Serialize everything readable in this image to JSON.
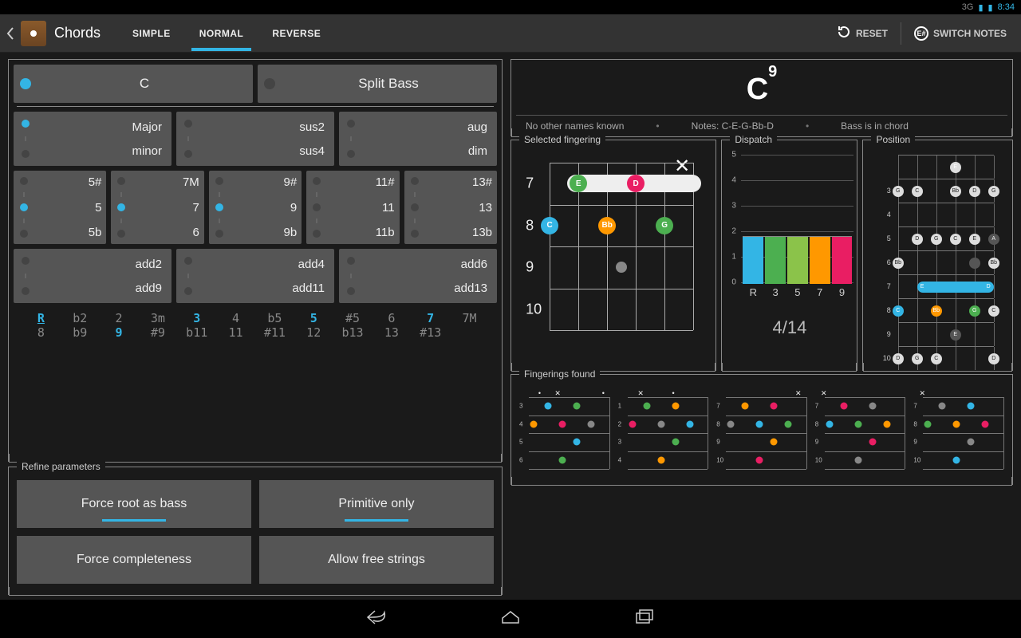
{
  "statusbar": {
    "net": "3G",
    "time": "8:34"
  },
  "appbar": {
    "title": "Chords",
    "tabs": [
      "SIMPLE",
      "NORMAL",
      "REVERSE"
    ],
    "active_tab": 1,
    "reset": "RESET",
    "switch": "SWITCH NOTES",
    "switch_icon": "E#"
  },
  "builder": {
    "root": {
      "note": "C",
      "split": "Split Bass"
    },
    "quality": {
      "items": [
        "Major",
        "minor"
      ],
      "selected": 0
    },
    "sus": {
      "items": [
        "sus2",
        "sus4"
      ]
    },
    "aug": {
      "items": [
        "aug",
        "dim"
      ]
    },
    "exts": [
      {
        "items": [
          "5#",
          "5",
          "5b"
        ],
        "selected": 1
      },
      {
        "items": [
          "7M",
          "7",
          "6"
        ],
        "selected": 1
      },
      {
        "items": [
          "9#",
          "9",
          "9b"
        ],
        "selected": 1
      },
      {
        "items": [
          "11#",
          "11",
          "11b"
        ],
        "selected": -1
      },
      {
        "items": [
          "13#",
          "13",
          "13b"
        ],
        "selected": -1
      }
    ],
    "adds": [
      {
        "items": [
          "add2",
          "add9"
        ]
      },
      {
        "items": [
          "add4",
          "add11"
        ]
      },
      {
        "items": [
          "add6",
          "add13"
        ]
      }
    ],
    "intervals_row1": [
      {
        "t": "R",
        "hl": true,
        "ul": true
      },
      {
        "t": "b2"
      },
      {
        "t": "2"
      },
      {
        "t": "3m"
      },
      {
        "t": "3",
        "hl": true
      },
      {
        "t": "4"
      },
      {
        "t": "b5"
      },
      {
        "t": "5",
        "hl": true
      },
      {
        "t": "#5"
      },
      {
        "t": "6"
      },
      {
        "t": "7",
        "hl": true
      },
      {
        "t": "7M"
      }
    ],
    "intervals_row2": [
      {
        "t": "8"
      },
      {
        "t": "b9"
      },
      {
        "t": "9",
        "hl": true
      },
      {
        "t": "#9"
      },
      {
        "t": "b11"
      },
      {
        "t": "11"
      },
      {
        "t": "#11"
      },
      {
        "t": "12"
      },
      {
        "t": "b13"
      },
      {
        "t": "13"
      },
      {
        "t": "#13"
      },
      {
        "t": ""
      }
    ]
  },
  "refine": {
    "legend": "Refine parameters",
    "buttons": [
      {
        "label": "Force root as bass",
        "on": true
      },
      {
        "label": "Primitive only",
        "on": true
      },
      {
        "label": "Force completeness",
        "on": false
      },
      {
        "label": "Allow free strings",
        "on": false
      }
    ]
  },
  "result": {
    "name_base": "C",
    "name_sup": "9",
    "info_names": "No other names known",
    "info_notes": "Notes: C-E-G-Bb-D",
    "info_bass": "Bass is in chord",
    "selected_legend": "Selected fingering",
    "dispatch_legend": "Dispatch",
    "position_legend": "Position",
    "fingerings_legend": "Fingerings found",
    "fret_labels": [
      "7",
      "8",
      "9",
      "10"
    ],
    "dispatch": {
      "ymax": 5,
      "yticks": [
        5,
        4,
        3,
        2,
        1,
        0
      ],
      "labels": [
        "R",
        "3",
        "5",
        "7",
        "9"
      ],
      "count": "4/14"
    },
    "minis": [
      {
        "frets": [
          "3",
          "4",
          "5",
          "6"
        ],
        "tops": [
          "",
          "●",
          "✕",
          "",
          "",
          "●"
        ]
      },
      {
        "frets": [
          "1",
          "2",
          "3",
          "4"
        ],
        "tops": [
          "",
          "✕",
          "",
          "●",
          "",
          ""
        ]
      },
      {
        "frets": [
          "7",
          "8",
          "9",
          "10"
        ],
        "tops": [
          "",
          "",
          "",
          "",
          "",
          "✕"
        ]
      },
      {
        "frets": [
          "7",
          "8",
          "9",
          "10"
        ],
        "tops": [
          "✕",
          "",
          "",
          "",
          "",
          ""
        ]
      },
      {
        "frets": [
          "7",
          "8",
          "9",
          "10"
        ],
        "tops": [
          "✕",
          "",
          "",
          "",
          "",
          ""
        ]
      }
    ]
  },
  "colors": {
    "R": "#33b5e5",
    "3": "#4caf50",
    "5": "#ff9800",
    "7": "#e91e63",
    "9": "#9e9e9e",
    "E": "#4caf50",
    "C": "#33b5e5",
    "Bb": "#ff9800",
    "D": "#e91e63",
    "G": "#ff9800"
  },
  "chart_data": {
    "type": "bar",
    "categories": [
      "R",
      "3",
      "5",
      "7",
      "9"
    ],
    "values": [
      1,
      1,
      1,
      1,
      1
    ],
    "ylim": [
      0,
      5
    ],
    "ylabel": "",
    "xlabel": "",
    "title": "Dispatch"
  }
}
